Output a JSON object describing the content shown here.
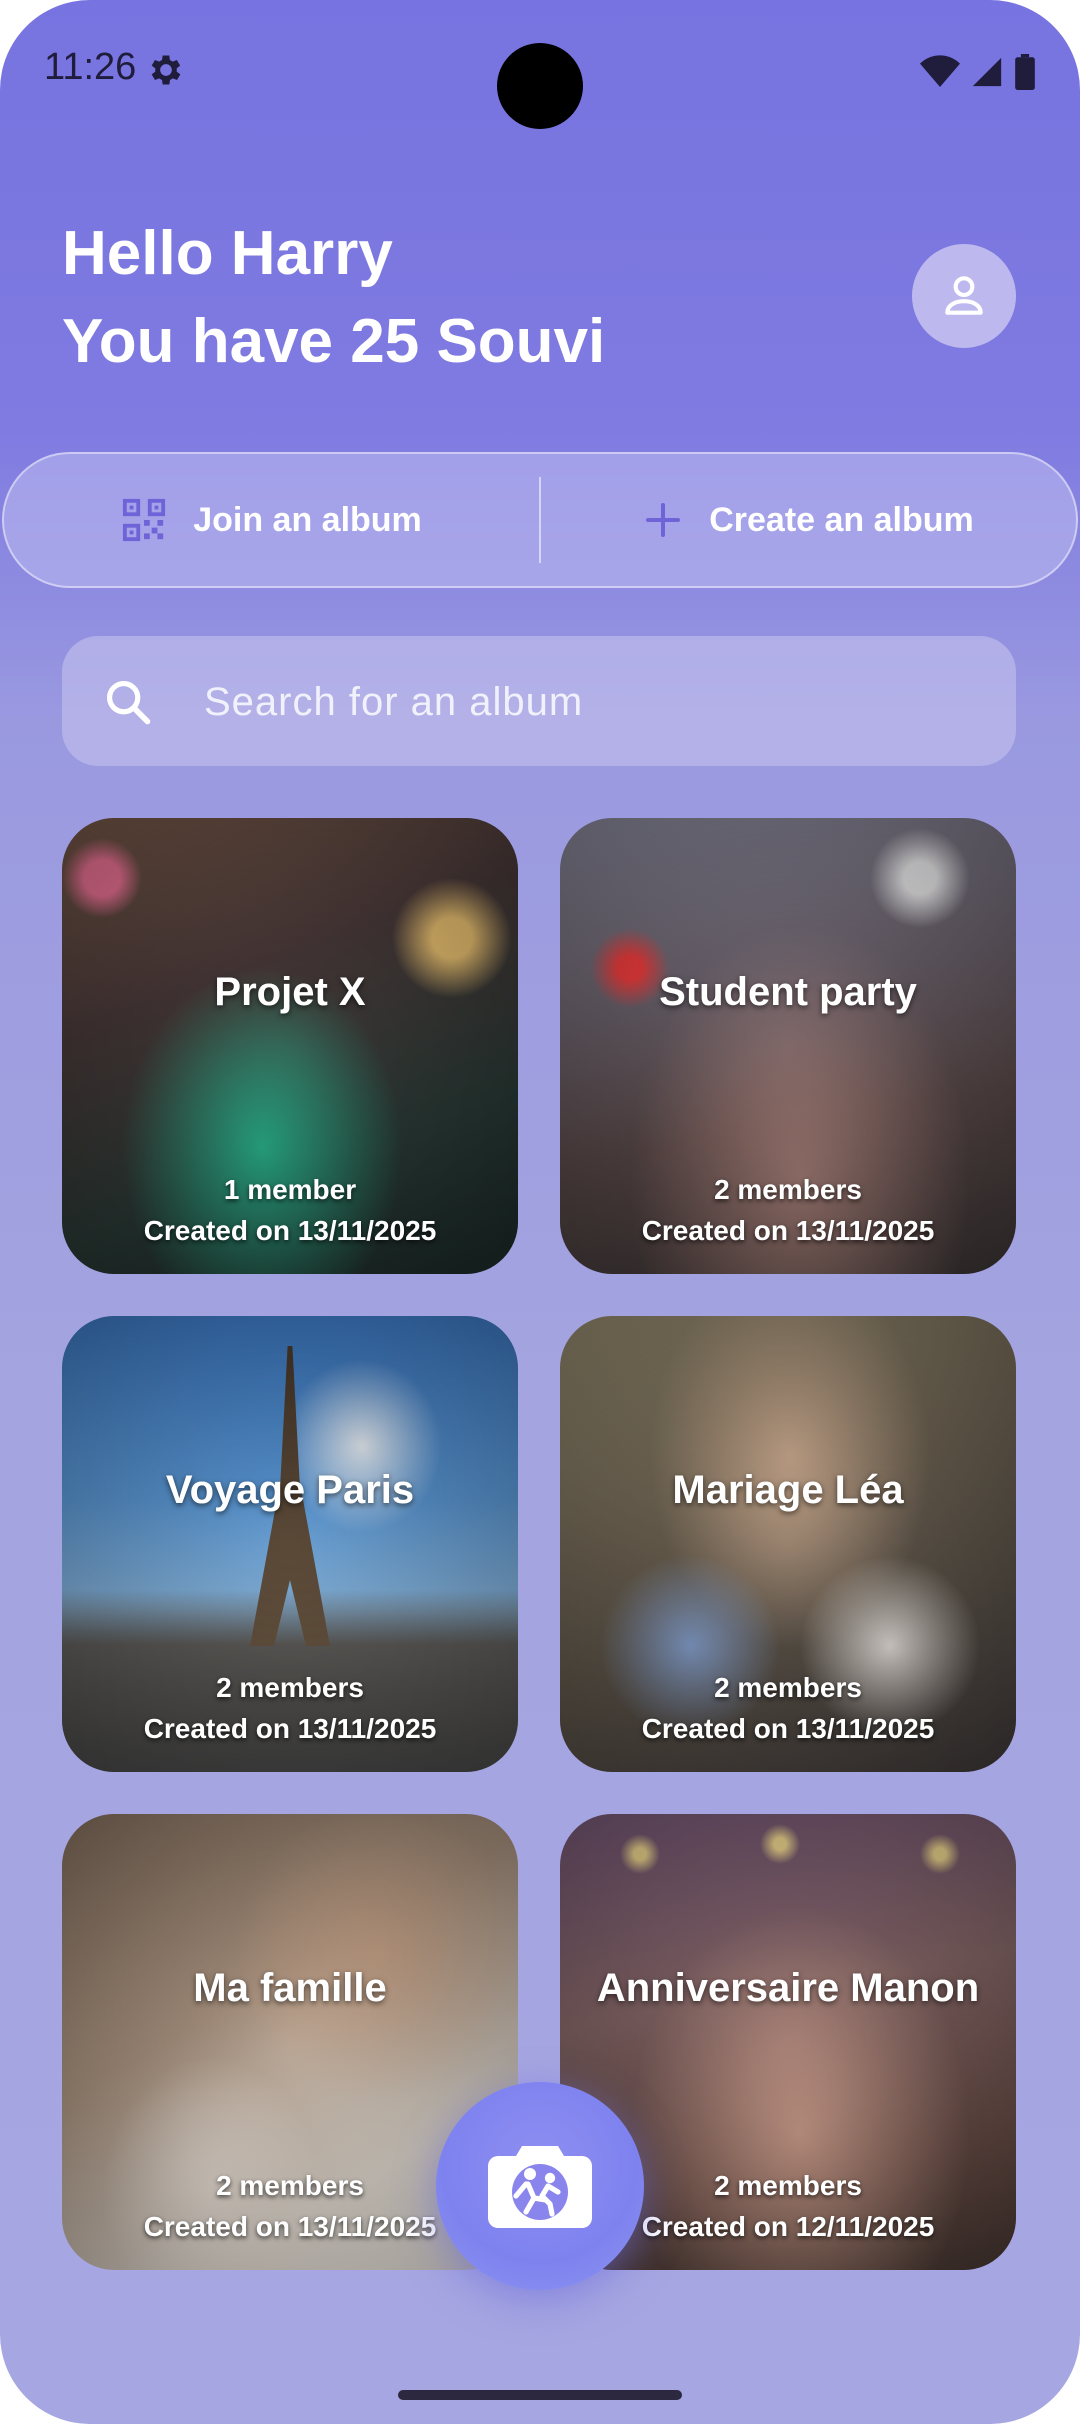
{
  "status_bar": {
    "time": "11:26"
  },
  "header": {
    "greeting": "Hello Harry",
    "subtitle": "You have 25 Souvi"
  },
  "actions": {
    "join_label": "Join an album",
    "create_label": "Create an album"
  },
  "search": {
    "placeholder": "Search for an album",
    "value": ""
  },
  "albums": [
    {
      "name": "Projet X",
      "members": "1 member",
      "created": "Created on 13/11/2025"
    },
    {
      "name": "Student party",
      "members": "2 members",
      "created": "Created on 13/11/2025"
    },
    {
      "name": "Voyage Paris",
      "members": "2 members",
      "created": "Created on 13/11/2025"
    },
    {
      "name": "Mariage Léa",
      "members": "2 members",
      "created": "Created on 13/11/2025"
    },
    {
      "name": "Ma famille",
      "members": "2 members",
      "created": "Created on 13/11/2025"
    },
    {
      "name": "Anniversaire Manon",
      "members": "2 members",
      "created": "Created on 12/11/2025"
    }
  ],
  "icons": {
    "settings": "gear-icon",
    "wifi": "wifi-icon",
    "signal": "signal-icon",
    "battery": "battery-icon",
    "profile": "person-icon",
    "join": "qr-code-icon",
    "create": "plus-icon",
    "search": "search-icon",
    "fab": "camera-icon"
  },
  "colors": {
    "accent": "#7773e0",
    "icon_purple": "#6f63d8",
    "card_text": "#ffffff"
  }
}
